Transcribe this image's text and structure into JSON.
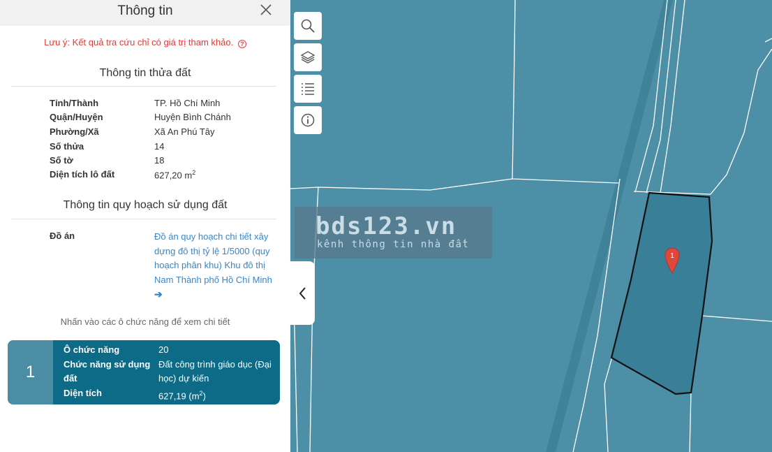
{
  "panel": {
    "title": "Thông tin",
    "note": "Lưu ý: Kết quả tra cứu chỉ có giá trị tham khảo.",
    "land_section_title": "Thông tin thửa đất",
    "land_info": [
      {
        "label": "Tỉnh/Thành",
        "value": "TP. Hồ Chí Minh"
      },
      {
        "label": "Quận/Huyện",
        "value": "Huyện Bình Chánh"
      },
      {
        "label": "Phường/Xã",
        "value": "Xã An Phú Tây"
      },
      {
        "label": "Số thửa",
        "value": "14"
      },
      {
        "label": "Số tờ",
        "value": "18"
      },
      {
        "label": "Diện tích lô đất",
        "value": "627,20 m",
        "sup": "2"
      }
    ],
    "planning_section_title": "Thông tin quy hoạch sử dụng đất",
    "plan_label": "Đồ án",
    "plan_link": "Đồ án quy hoạch chi tiết xây dựng đô thị tỷ lệ 1/5000 (quy hoạch phân khu) Khu đô thị Nam Thành phố Hồ Chí Minh",
    "plan_arrow": "➔",
    "hint": "Nhấn vào các ô chức năng để xem chi tiết",
    "card": {
      "number": "1",
      "rows": [
        {
          "label": "Ô chức năng",
          "value": "20"
        },
        {
          "label": "Chức năng sử dụng đất",
          "value": "Đất công trình giáo dục (Đại học) dự kiến"
        },
        {
          "label": "Diện tích",
          "value": "627,19 (m",
          "sup": "2",
          "tail": ")"
        }
      ]
    }
  },
  "map": {
    "tools": [
      "search-icon",
      "layers-icon",
      "list-icon",
      "info-icon"
    ],
    "toggle": "chevron-left-icon",
    "watermark_main": "bds123.vn",
    "watermark_sub": "kênh thông tin nhà đất",
    "pin_label": "1",
    "colors": {
      "map": "#4c8fa6",
      "parcel": "#3f819a",
      "pin": "#e0473c",
      "card": "#0d6b87"
    }
  }
}
